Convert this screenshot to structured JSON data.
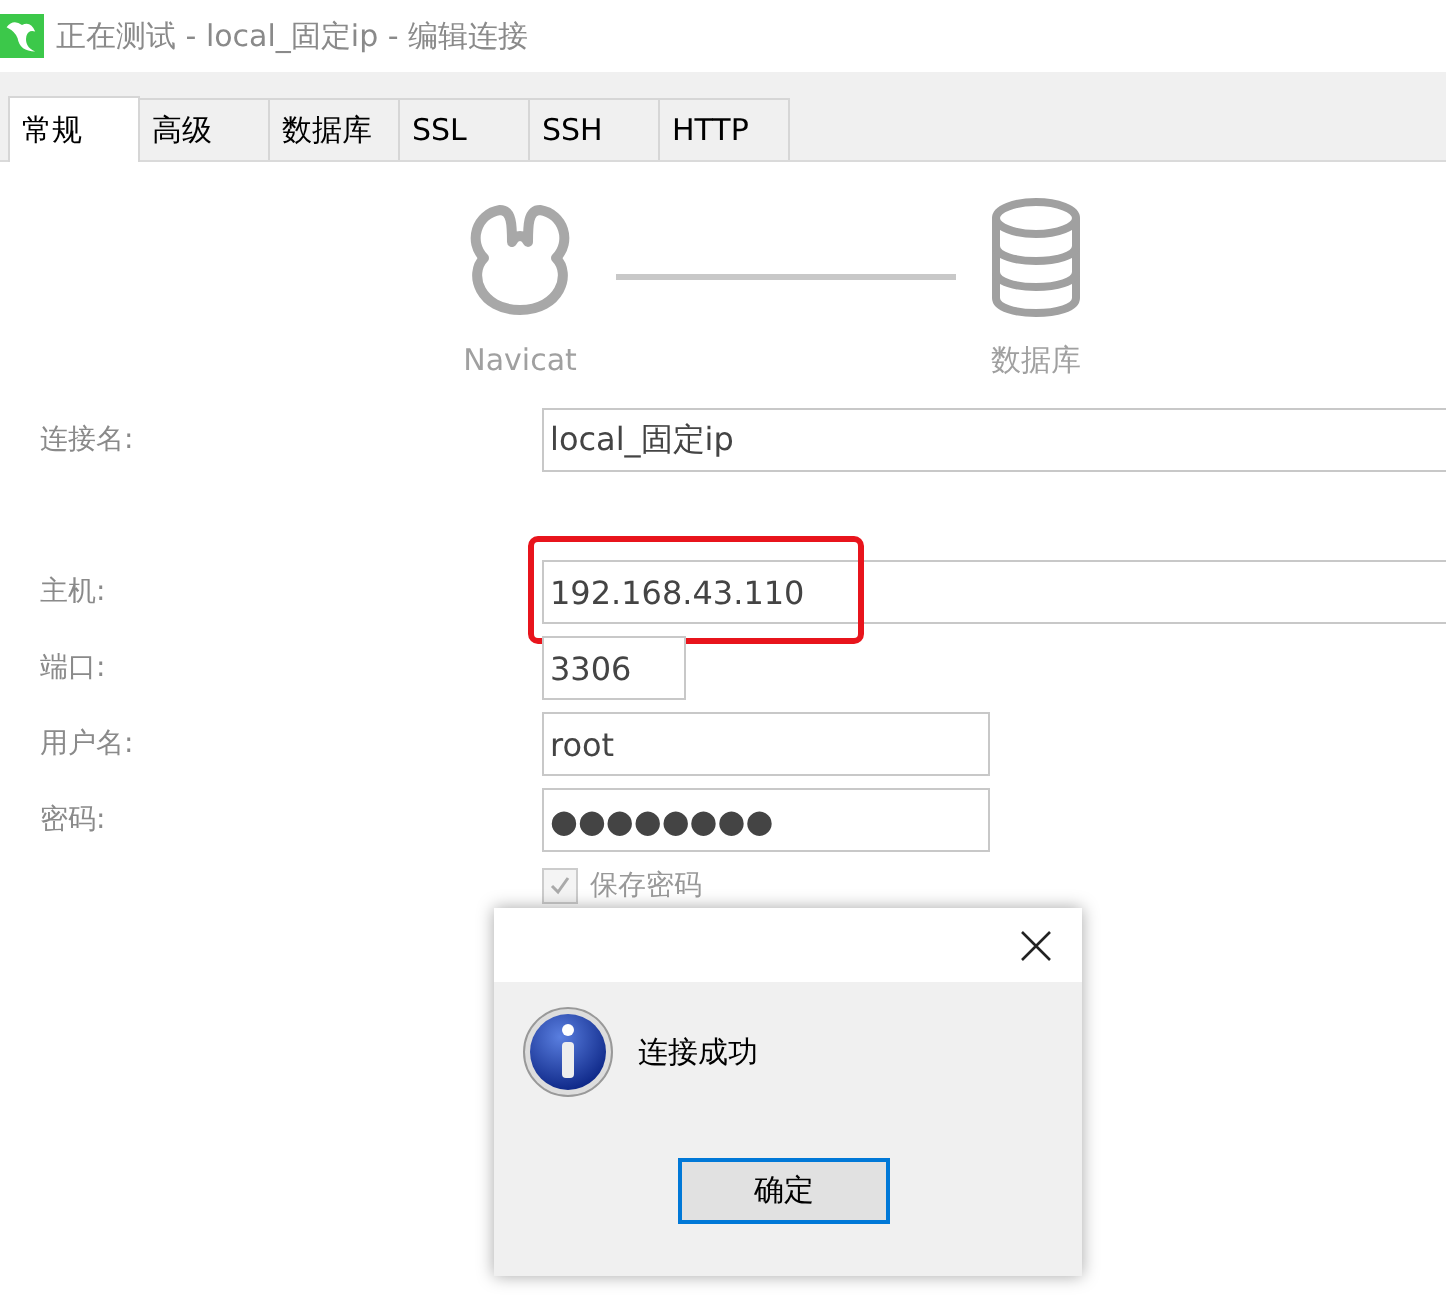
{
  "window": {
    "title": "正在测试 - local_固定ip - 编辑连接"
  },
  "tabs": [
    {
      "label": "常规",
      "selected": true
    },
    {
      "label": "高级",
      "selected": false
    },
    {
      "label": "数据库",
      "selected": false
    },
    {
      "label": "SSL",
      "selected": false
    },
    {
      "label": "SSH",
      "selected": false
    },
    {
      "label": "HTTP",
      "selected": false
    }
  ],
  "diagram": {
    "client_label": "Navicat",
    "server_label": "数据库"
  },
  "fields": [
    {
      "label": "连接名:",
      "value": "local_固定ip",
      "highlighted": false
    },
    {
      "label": "主机:",
      "value": "192.168.43.110",
      "highlighted": true
    },
    {
      "label": "端口:",
      "value": "3306",
      "highlighted": false
    },
    {
      "label": "用户名:",
      "value": "root",
      "highlighted": false
    },
    {
      "label": "密码:",
      "value": "●●●●●●●●",
      "highlighted": false
    }
  ],
  "save_password": {
    "label": "保存密码",
    "checked": true
  },
  "dialog": {
    "message": "连接成功",
    "button": "确定"
  }
}
